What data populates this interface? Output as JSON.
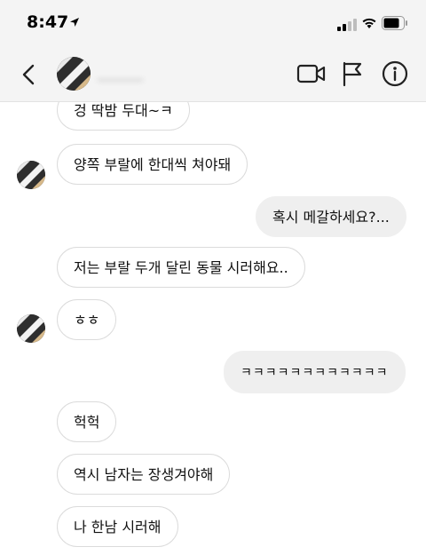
{
  "status_bar": {
    "time": "8:47"
  },
  "header": {
    "contact_name": "______"
  },
  "messages": [
    {
      "side": "received",
      "text": "겅 딱밤 두대~ㅋ"
    },
    {
      "side": "received",
      "text": "양쪽 부랄에 한대씩 쳐야돼"
    },
    {
      "side": "sent",
      "text": "혹시 메갈하세요?..."
    },
    {
      "side": "received",
      "text": "저는 부랄 두개 달린 동물 시러해요.."
    },
    {
      "side": "received",
      "text": "ㅎㅎ"
    },
    {
      "side": "sent",
      "text": "ㅋㅋㅋㅋㅋㅋㅋㅋㅋㅋㅋㅋ"
    },
    {
      "side": "received",
      "text": "헉헉"
    },
    {
      "side": "received",
      "text": "역시 남자는 장생겨야해"
    },
    {
      "side": "received",
      "text": "나 한남 시러해"
    }
  ],
  "colors": {
    "sent_bubble": "#efefef",
    "received_border": "#dbdbdb",
    "header_bg": "#f4f4f4"
  },
  "icons": [
    "location-arrow-icon",
    "signal-icon",
    "wifi-icon",
    "battery-icon",
    "back-chevron-icon",
    "video-call-icon",
    "flag-icon",
    "info-icon"
  ]
}
